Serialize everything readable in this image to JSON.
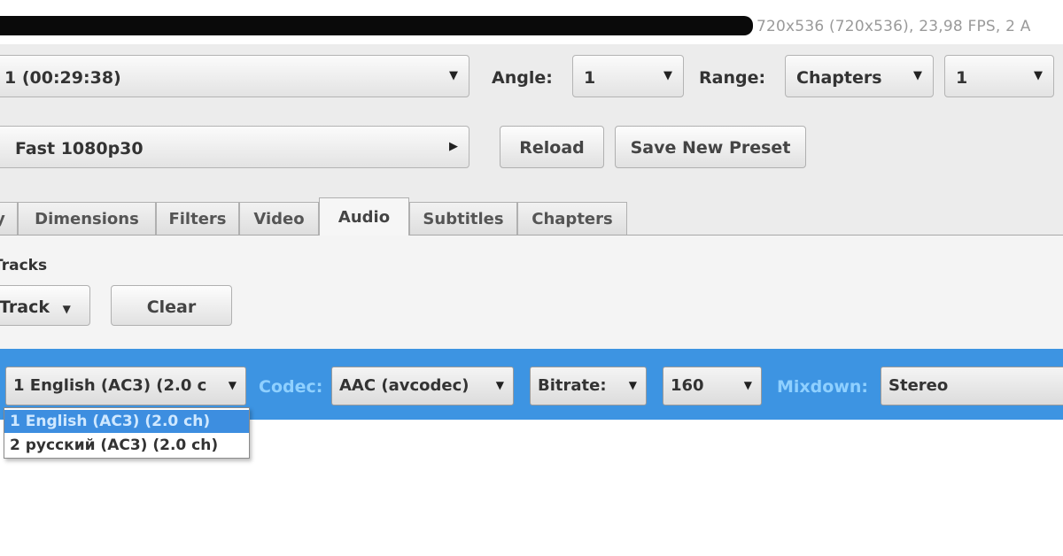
{
  "source": {
    "info": "720x536 (720x536), 23,98 FPS, 2 A"
  },
  "title_selector": {
    "value": "1 (00:29:38)"
  },
  "angle": {
    "label": "Angle:",
    "value": "1"
  },
  "range": {
    "label": "Range:",
    "type_value": "Chapters",
    "start_value": "1"
  },
  "preset": {
    "value": "Fast 1080p30",
    "reload_label": "Reload",
    "save_new_label": "Save New Preset"
  },
  "tabs": [
    {
      "label": "y"
    },
    {
      "label": "Dimensions"
    },
    {
      "label": "Filters"
    },
    {
      "label": "Video"
    },
    {
      "label": "Audio"
    },
    {
      "label": "Subtitles"
    },
    {
      "label": "Chapters"
    }
  ],
  "active_tab": "Audio",
  "audio": {
    "section_label": "Tracks",
    "add_track_label": "Track",
    "clear_label": "Clear",
    "track": {
      "source_value": "1 English (AC3) (2.0 c",
      "codec_label": "Codec:",
      "codec_value": "AAC (avcodec)",
      "bitrate_mode": "Bitrate:",
      "bitrate_value": "160",
      "mixdown_label": "Mixdown:",
      "mixdown_value": "Stereo"
    },
    "source_options": [
      "1 English (AC3) (2.0 ch)",
      "2 русский (AC3) (2.0 ch)"
    ]
  },
  "colors": {
    "selection_blue": "#3d94e2",
    "label_on_blue": "#8fd0ff"
  }
}
